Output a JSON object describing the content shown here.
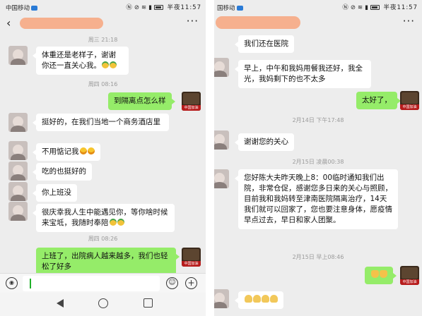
{
  "left_phone": {
    "status": {
      "carrier": "中国移动",
      "clock": "半夜11:57"
    },
    "chat_title": "",
    "messages": [
      {
        "type": "time",
        "text": "周三 21:18"
      },
      {
        "type": "in",
        "text": "体重还是老样子，谢谢你还一直关心我。",
        "emoji": [
          "sprout",
          "sprout"
        ]
      },
      {
        "type": "time",
        "text": "周四 08:16"
      },
      {
        "type": "out",
        "text": "到隔离点怎么样"
      },
      {
        "type": "in",
        "text": "挺好的，在我们当地一个商务酒店里"
      },
      {
        "type": "in",
        "text": "不用惦记我",
        "emoji": [
          "grin",
          "grin"
        ]
      },
      {
        "type": "in",
        "text": "吃的也挺好的"
      },
      {
        "type": "in",
        "text": "你上班没"
      },
      {
        "type": "in",
        "text": "很庆幸我人生中能遇见你，等你啥时候来宝坻，我随时奉陪",
        "emoji": [
          "sprout",
          "sprout"
        ]
      },
      {
        "type": "time",
        "text": "周四 08:26"
      },
      {
        "type": "out",
        "text": "上班了，出院病人越来越多，我们也轻松了好多"
      }
    ],
    "input": {
      "value": ""
    }
  },
  "right_phone": {
    "status": {
      "carrier": "国移动",
      "clock": "半夜11:57"
    },
    "chat_title": "",
    "messages": [
      {
        "type": "in",
        "text": "我们还在医院"
      },
      {
        "type": "in",
        "text": "早上，中午和我妈用餐我还好，我全光，我妈剩下的也不太多"
      },
      {
        "type": "out",
        "text": "太好了，"
      },
      {
        "type": "time",
        "text": "2月14日 下午17:48"
      },
      {
        "type": "in",
        "text": "谢谢您的关心"
      },
      {
        "type": "time",
        "text": "2月15日 凌晨00:38"
      },
      {
        "type": "in",
        "text": "您好陈大夫昨天晚上8：00临时通知我们出院，非常仓促，感谢您多日来的关心与照顾，目前我和我妈转至津南医院隔离治疗，14天我们就可以回家了，您也要注意身体，愿疫情早点过去，早日和家人团聚。"
      },
      {
        "type": "time",
        "text": "2月15日 早上08:46"
      },
      {
        "type": "out",
        "text": "",
        "emoji": [
          "thumb",
          "thumb"
        ]
      },
      {
        "type": "in",
        "text": "",
        "emoji": [
          "pray",
          "pray",
          "pray",
          "pray"
        ]
      }
    ]
  }
}
